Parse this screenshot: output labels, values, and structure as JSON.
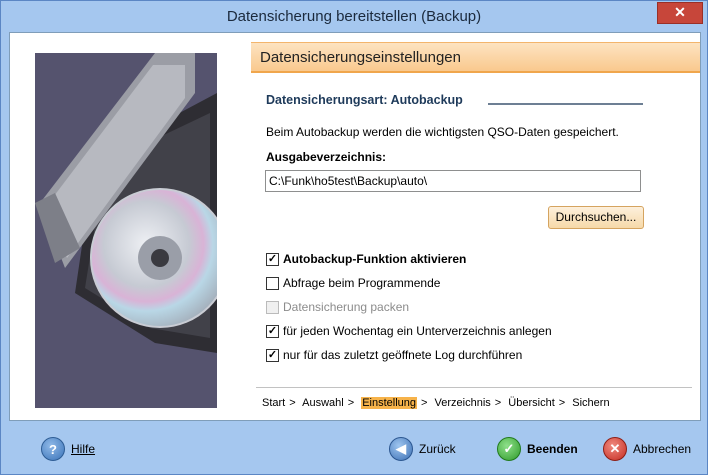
{
  "window": {
    "title": "Datensicherung bereitstellen (Backup)",
    "close_label": "✕"
  },
  "section": {
    "title": "Datensicherungseinstellungen"
  },
  "backup_type": {
    "label": "Datensicherungsart: Autobackup"
  },
  "description": "Beim Autobackup werden die wichtigsten QSO-Daten gespeichert.",
  "output": {
    "label": "Ausgabeverzeichnis:",
    "value": "C:\\Funk\\ho5test\\Backup\\auto\\"
  },
  "browse_label": "Durchsuchen...",
  "options": [
    {
      "label": "Autobackup-Funktion aktivieren",
      "checked": true,
      "bold": true,
      "disabled": false
    },
    {
      "label": "Abfrage beim Programmende",
      "checked": false,
      "bold": false,
      "disabled": false
    },
    {
      "label": "Datensicherung packen",
      "checked": false,
      "bold": false,
      "disabled": true
    },
    {
      "label": "für jeden Wochentag  ein Unterverzeichnis anlegen",
      "checked": true,
      "bold": false,
      "disabled": false
    },
    {
      "label": "nur für das zuletzt geöffnete Log durchführen",
      "checked": true,
      "bold": false,
      "disabled": false
    }
  ],
  "steps": [
    "Start",
    ">",
    "Auswahl",
    ">",
    "Einstellung",
    ">",
    "Verzeichnis",
    ">",
    "Übersicht",
    ">",
    "Sichern"
  ],
  "footer": {
    "help": "Hilfe",
    "back": "Zurück",
    "finish": "Beenden",
    "cancel": "Abbrechen"
  },
  "icons": {
    "help": "question-icon",
    "back": "arrow-left-icon",
    "finish": "checkmark-icon",
    "cancel": "x-icon"
  },
  "colors": {
    "accent": "#f7b34a",
    "titlebar": "#a5c7ef",
    "close": "#c7463a"
  }
}
